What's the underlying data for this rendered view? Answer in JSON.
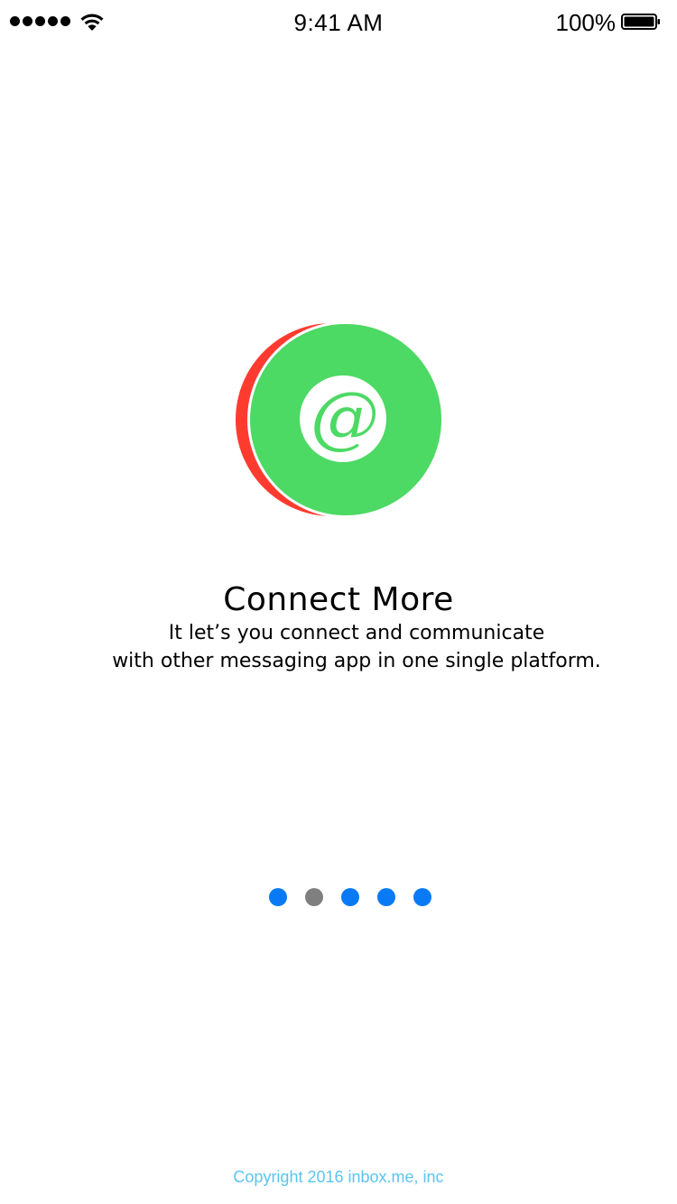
{
  "status_bar": {
    "time": "9:41 AM",
    "battery_percent": "100%",
    "signal_bars": 5,
    "wifi_icon": "wifi-icon",
    "battery_icon": "battery-full-icon"
  },
  "logo": {
    "icon": "at-sign-icon",
    "glyph": "@",
    "colors": {
      "front_circle": "#4CD964",
      "back_crescent": "#FF3B30",
      "inner_circle": "#FFFFFF",
      "glyph": "#4CD964"
    }
  },
  "onboarding": {
    "title": "Connect More",
    "description_line1": "It let’s you connect and communicate",
    "description_line2": "with other messaging app in one single platform."
  },
  "pager": {
    "page_count": 5,
    "current_page": 2,
    "colors": {
      "active": "#7F7F7F",
      "inactive": "#087AF6"
    }
  },
  "footer": {
    "copyright": "Copyright 2016 inbox.me, inc",
    "color": "#5BC4F0"
  }
}
